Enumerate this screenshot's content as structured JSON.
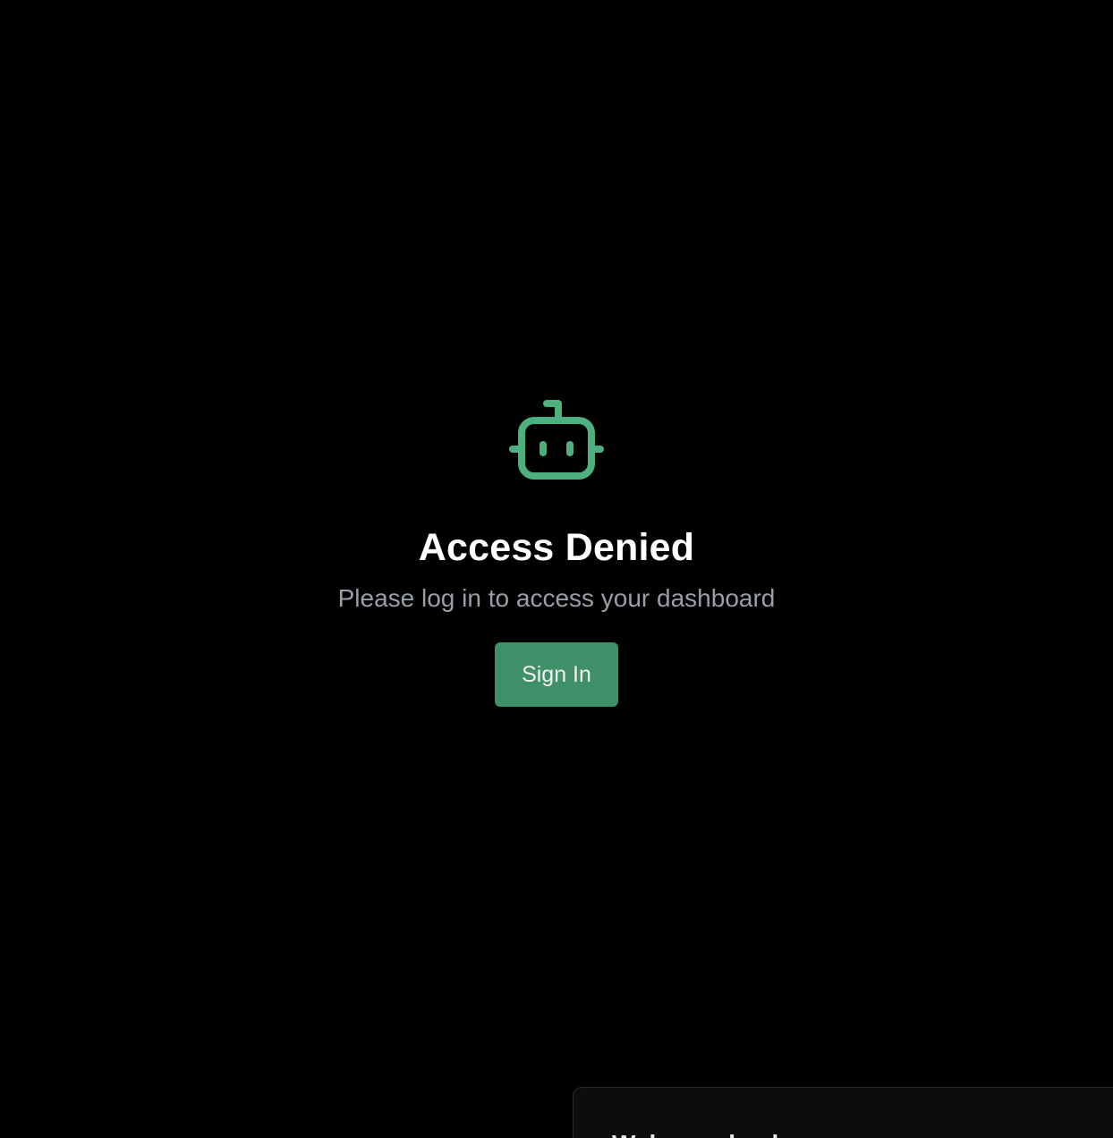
{
  "colors": {
    "background": "#000000",
    "accent": "#4fb07f",
    "button_bg": "#3f8f68",
    "button_text": "#f2f2f2",
    "title_text": "#ffffff",
    "subtitle_text": "#9a9ea6"
  },
  "access": {
    "icon": "bot-icon",
    "title": "Access Denied",
    "message": "Please log in to access your dashboard",
    "button_label": "Sign In"
  },
  "toast": {
    "text": "Welcome back"
  }
}
